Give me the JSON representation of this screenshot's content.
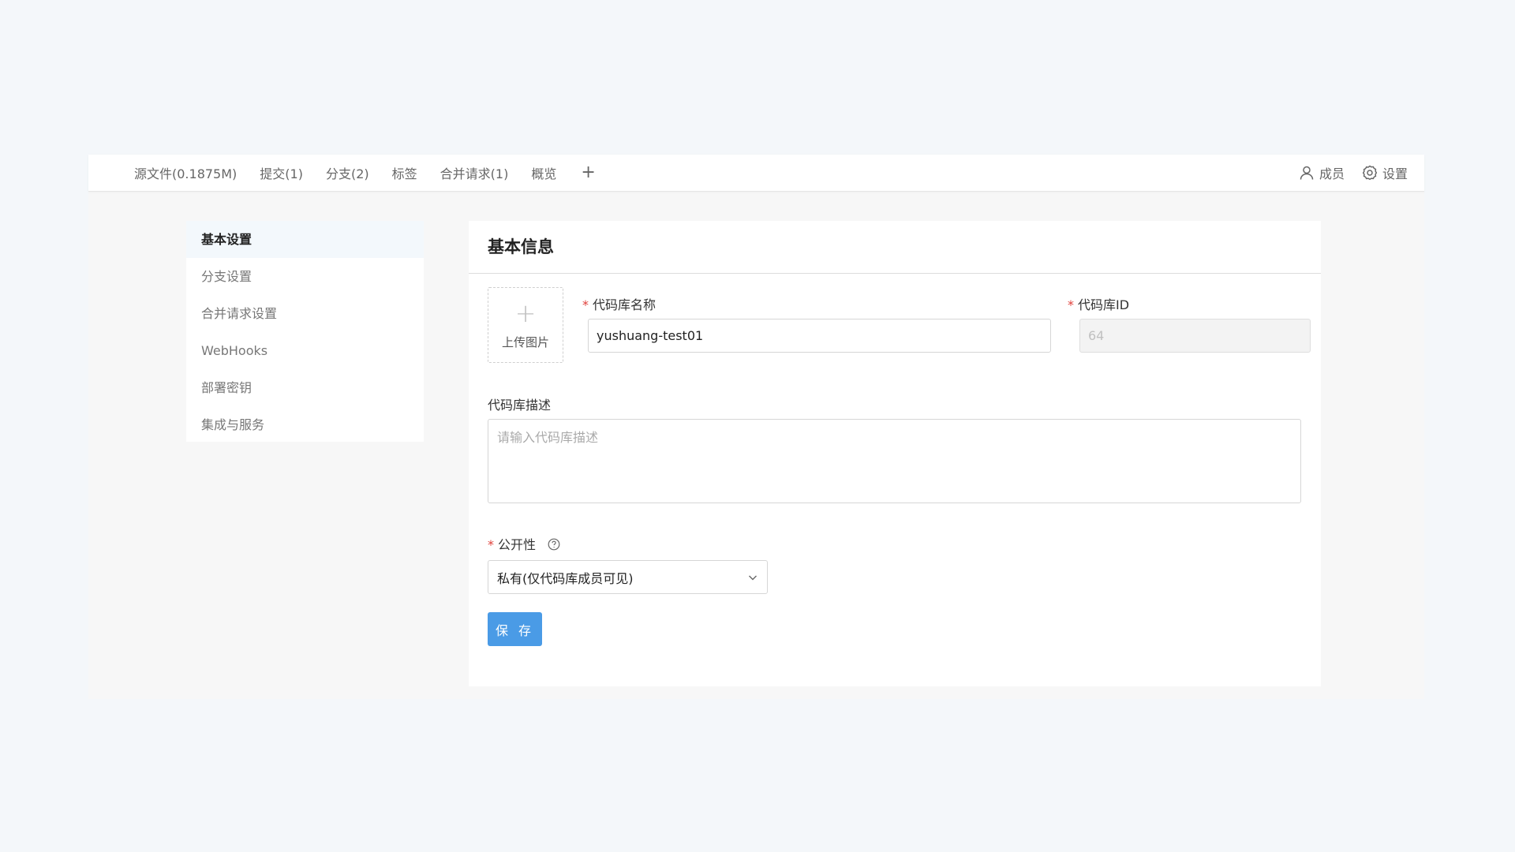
{
  "topnav": {
    "tabs": [
      {
        "label": "源文件(0.1875M)"
      },
      {
        "label": "提交(1)"
      },
      {
        "label": "分支(2)"
      },
      {
        "label": "标签"
      },
      {
        "label": "合并请求(1)"
      },
      {
        "label": "概览"
      }
    ],
    "add_label": "+",
    "members_label": "成员",
    "settings_label": "设置"
  },
  "sidebar": {
    "items": [
      {
        "label": "基本设置",
        "active": true
      },
      {
        "label": "分支设置"
      },
      {
        "label": "合并请求设置"
      },
      {
        "label": "WebHooks"
      },
      {
        "label": "部署密钥"
      },
      {
        "label": "集成与服务"
      }
    ]
  },
  "panel": {
    "title": "基本信息",
    "upload_label": "上传图片",
    "repo_name_label": "代码库名称",
    "repo_name_value": "yushuang-test01",
    "repo_id_label": "代码库ID",
    "repo_id_value": "64",
    "description_label": "代码库描述",
    "description_placeholder": "请输入代码库描述",
    "visibility_label": "公开性",
    "visibility_value": "私有(仅代码库成员可见)",
    "save_label": "保 存",
    "required_mark": "*"
  },
  "colors": {
    "primary": "#4a9be6",
    "required": "#e0413b",
    "active_bg": "#f3f8fc"
  },
  "icons": [
    "plus-icon",
    "user-icon",
    "gear-icon",
    "question-circle-icon",
    "chevron-down-icon"
  ]
}
